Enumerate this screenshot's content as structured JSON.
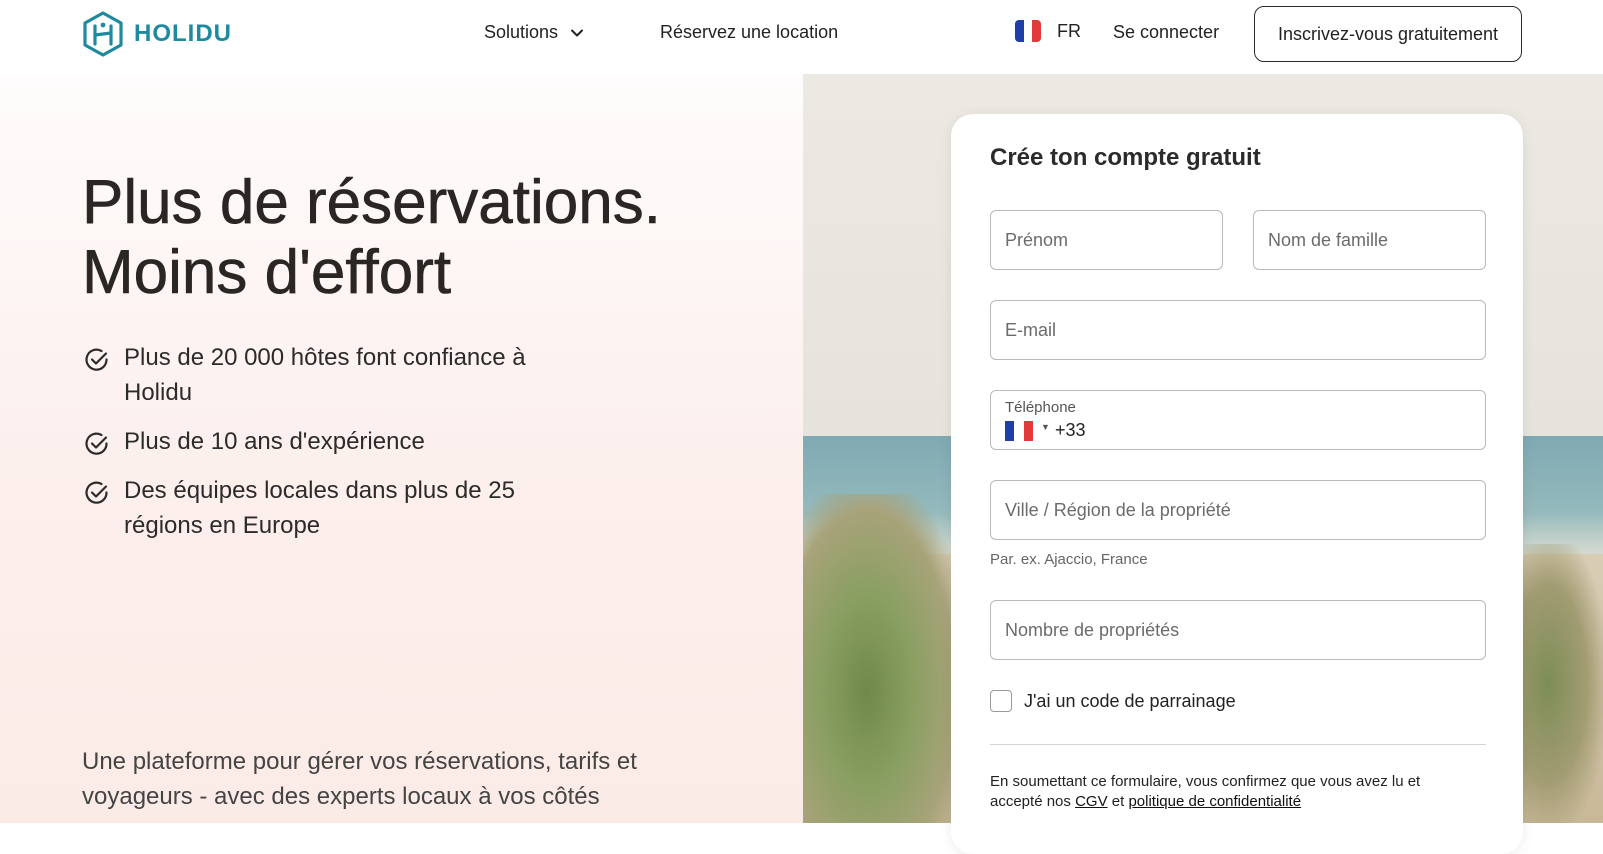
{
  "header": {
    "logo_text": "HOLIDU",
    "nav": {
      "solutions": "Solutions",
      "book_rental": "Réservez une location"
    },
    "language": {
      "code": "FR",
      "flag_colors": [
        "#1f3fa8",
        "#ffffff",
        "#e23a3a"
      ]
    },
    "login": "Se connecter",
    "signup": "Inscrivez-vous gratuitement"
  },
  "hero": {
    "title_line1": "Plus de réservations.",
    "title_line2": "Moins d'effort",
    "benefits": [
      {
        "text": "Plus de 20 000 hôtes font confiance à Holidu",
        "icon": "check-circle-icon"
      },
      {
        "text": "Plus de 10 ans d'expérience",
        "icon": "check-circle-icon"
      },
      {
        "text": "Des équipes locales dans plus de 25 régions en Europe",
        "icon": "check-circle-icon"
      }
    ],
    "tagline": "Une plateforme pour gérer vos réservations, tarifs et voyageurs - avec des experts locaux à vos côtés"
  },
  "form": {
    "title": "Crée ton compte gratuit",
    "first_name": {
      "placeholder": "Prénom",
      "value": ""
    },
    "last_name": {
      "placeholder": "Nom de famille",
      "value": ""
    },
    "email": {
      "placeholder": "E-mail",
      "value": ""
    },
    "phone": {
      "label": "Téléphone",
      "country_code": "+33"
    },
    "city": {
      "placeholder": "Ville / Région de la propriété",
      "value": "",
      "hint": "Par. ex. Ajaccio, France"
    },
    "properties": {
      "placeholder": "Nombre de propriétés",
      "value": ""
    },
    "referral_checkbox": {
      "label": "J'ai un code de parrainage",
      "checked": false
    },
    "legal": {
      "prefix": "En soumettant ce formulaire, vous confirmez que vous avez lu et accepté nos ",
      "cgv": "CGV",
      "and": " et ",
      "privacy": "politique de confidentialité"
    }
  },
  "colors": {
    "brand": "#1d8aa0",
    "text": "#2b2b2b",
    "hero_bg": "#fcefec"
  }
}
